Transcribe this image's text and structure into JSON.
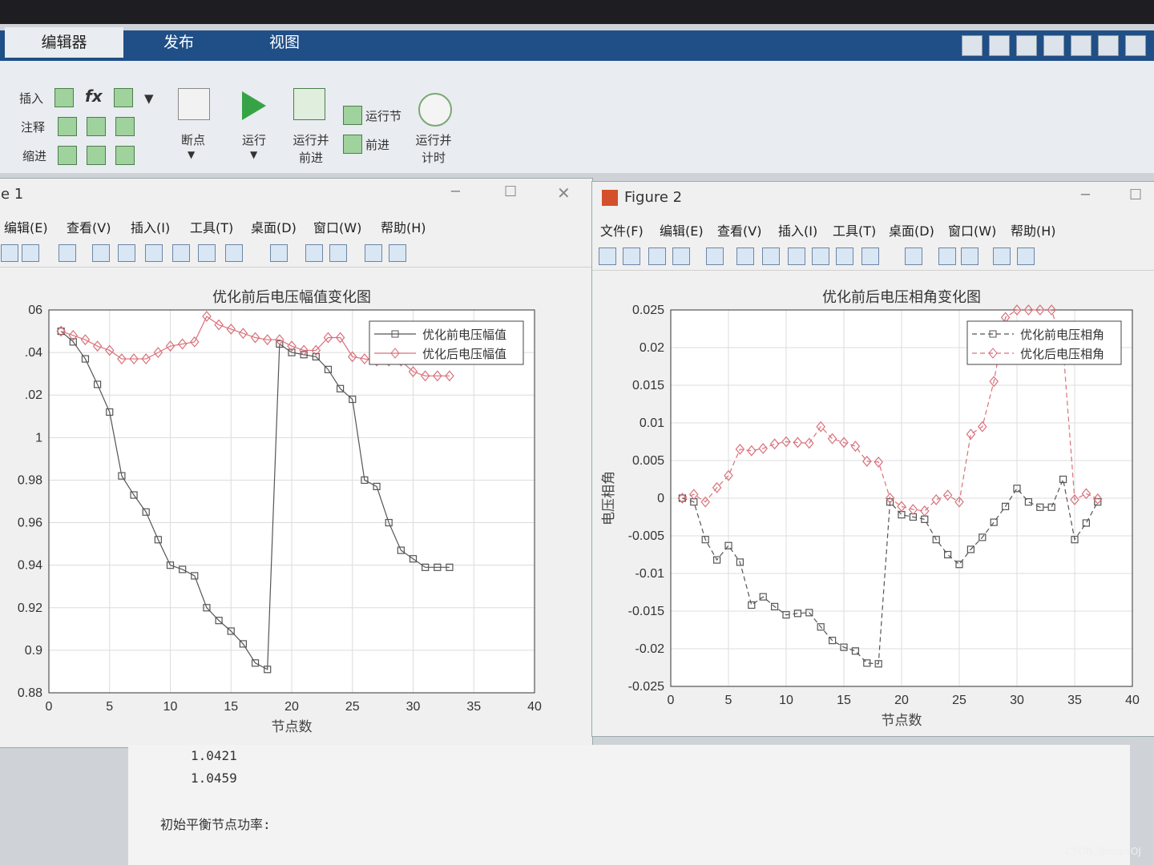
{
  "ribbon": {
    "tabs": [
      "编辑器",
      "发布",
      "视图"
    ],
    "row_labels": [
      "插入",
      "注释",
      "缩进"
    ],
    "fx_label": "fx",
    "breakpoint_label": "断点",
    "run_label": "运行",
    "run_advance_label": "运行并\n前进",
    "run_section_label": "运行节",
    "advance_label": "前进",
    "run_time_label": "运行并\n计时"
  },
  "fig1": {
    "title": "e 1",
    "menus": [
      "编辑(E)",
      "查看(V)",
      "插入(I)",
      "工具(T)",
      "桌面(D)",
      "窗口(W)",
      "帮助(H)"
    ]
  },
  "fig2": {
    "title": "Figure 2",
    "menus": [
      "文件(F)",
      "编辑(E)",
      "查看(V)",
      "插入(I)",
      "工具(T)",
      "桌面(D)",
      "窗口(W)",
      "帮助(H)"
    ]
  },
  "cmd": {
    "lines": [
      "1.0421",
      "1.0459",
      "初始平衡节点功率:"
    ]
  },
  "watermark": "CSDN @nsgIsOJ",
  "chart_data": [
    {
      "type": "line",
      "title": "优化前后电压幅值变化图",
      "xlabel": "节点数",
      "ylabel": "",
      "xlim": [
        0,
        40
      ],
      "ylim": [
        0.88,
        1.06
      ],
      "xticks": [
        0,
        5,
        10,
        15,
        20,
        25,
        30,
        35,
        40
      ],
      "yticks": [
        0.88,
        0.9,
        0.92,
        0.94,
        0.96,
        0.98,
        1,
        1.02,
        1.04,
        1.06
      ],
      "ytick_labels": [
        "0.88",
        "0.9",
        "0.92",
        "0.94",
        "0.96",
        "0.98",
        "1",
        ".02",
        ".04",
        "06"
      ],
      "grid": true,
      "legend_position": "top-right",
      "series": [
        {
          "name": "优化前电压幅值",
          "marker": "square",
          "color": "#555555",
          "x": [
            1,
            2,
            3,
            4,
            5,
            6,
            7,
            8,
            9,
            10,
            11,
            12,
            13,
            14,
            15,
            16,
            17,
            18,
            19,
            20,
            21,
            22,
            23,
            24,
            25,
            26,
            27,
            28,
            29,
            30,
            31,
            32,
            33
          ],
          "y": [
            1.05,
            1.045,
            1.037,
            1.025,
            1.012,
            0.982,
            0.973,
            0.965,
            0.952,
            0.94,
            0.938,
            0.935,
            0.92,
            0.914,
            0.909,
            0.903,
            0.894,
            0.891,
            1.044,
            1.04,
            1.039,
            1.038,
            1.032,
            1.023,
            1.018,
            0.98,
            0.977,
            0.96,
            0.947,
            0.943,
            0.939,
            0.939,
            0.939
          ]
        },
        {
          "name": "优化后电压幅值",
          "marker": "diamond",
          "color": "#d9707a",
          "x": [
            1,
            2,
            3,
            4,
            5,
            6,
            7,
            8,
            9,
            10,
            11,
            12,
            13,
            14,
            15,
            16,
            17,
            18,
            19,
            20,
            21,
            22,
            23,
            24,
            25,
            26,
            27,
            28,
            29,
            30,
            31,
            32,
            33
          ],
          "y": [
            1.05,
            1.048,
            1.046,
            1.043,
            1.041,
            1.037,
            1.037,
            1.037,
            1.04,
            1.043,
            1.044,
            1.045,
            1.057,
            1.053,
            1.051,
            1.049,
            1.047,
            1.046,
            1.046,
            1.043,
            1.041,
            1.041,
            1.047,
            1.047,
            1.038,
            1.037,
            1.036,
            1.036,
            1.036,
            1.031,
            1.029,
            1.029,
            1.029
          ]
        }
      ]
    },
    {
      "type": "line",
      "title": "优化前后电压相角变化图",
      "xlabel": "节点数",
      "ylabel": "电压相角",
      "xlim": [
        0,
        40
      ],
      "ylim": [
        -0.025,
        0.025
      ],
      "xticks": [
        0,
        5,
        10,
        15,
        20,
        25,
        30,
        35,
        40
      ],
      "yticks": [
        -0.025,
        -0.02,
        -0.015,
        -0.01,
        -0.005,
        0,
        0.005,
        0.01,
        0.015,
        0.02,
        0.025
      ],
      "ytick_labels": [
        "-0.025",
        "-0.02",
        "-0.015",
        "-0.01",
        "-0.005",
        "0",
        "0.005",
        "0.01",
        "0.015",
        "0.02",
        "0.025"
      ],
      "grid": true,
      "legend_position": "top-right",
      "series": [
        {
          "name": "优化前电压相角",
          "marker": "square",
          "color": "#555555",
          "x": [
            1,
            2,
            3,
            4,
            5,
            6,
            7,
            8,
            9,
            10,
            11,
            12,
            13,
            14,
            15,
            16,
            17,
            18,
            19,
            20,
            21,
            22,
            23,
            24,
            25,
            26,
            27,
            28,
            29,
            30,
            31,
            32,
            33,
            34,
            35,
            36,
            37
          ],
          "y": [
            0,
            -0.0005,
            -0.0055,
            -0.0082,
            -0.0063,
            -0.0085,
            -0.0142,
            -0.0131,
            -0.0144,
            -0.0155,
            -0.0153,
            -0.0152,
            -0.0171,
            -0.0189,
            -0.0198,
            -0.0203,
            -0.0219,
            -0.022,
            -0.0005,
            -0.0022,
            -0.0025,
            -0.0028,
            -0.0055,
            -0.0075,
            -0.0088,
            -0.0068,
            -0.0052,
            -0.0032,
            -0.0011,
            0.0013,
            -0.0005,
            -0.0012,
            -0.0012,
            0.0025,
            -0.0055,
            -0.0033,
            -0.0005
          ]
        },
        {
          "name": "优化后电压相角",
          "marker": "diamond",
          "color": "#d9707a",
          "x": [
            1,
            2,
            3,
            4,
            5,
            6,
            7,
            8,
            9,
            10,
            11,
            12,
            13,
            14,
            15,
            16,
            17,
            18,
            19,
            20,
            21,
            22,
            23,
            24,
            25,
            26,
            27,
            28,
            29,
            30,
            31,
            32,
            33,
            34,
            35,
            36,
            37
          ],
          "y": [
            0,
            0.0005,
            -0.0005,
            0.0014,
            0.003,
            0.0065,
            0.0063,
            0.0066,
            0.0072,
            0.0075,
            0.0074,
            0.0073,
            0.0095,
            0.0079,
            0.0074,
            0.0069,
            0.0049,
            0.0048,
            0.0,
            -0.0011,
            -0.0015,
            -0.0017,
            -0.0002,
            0.0004,
            -0.0005,
            0.0085,
            0.0095,
            0.0155,
            0.024,
            0.025,
            0.025,
            0.025,
            0.025,
            0.02,
            -0.0002,
            0.0006,
            -0.0001
          ]
        }
      ]
    }
  ]
}
